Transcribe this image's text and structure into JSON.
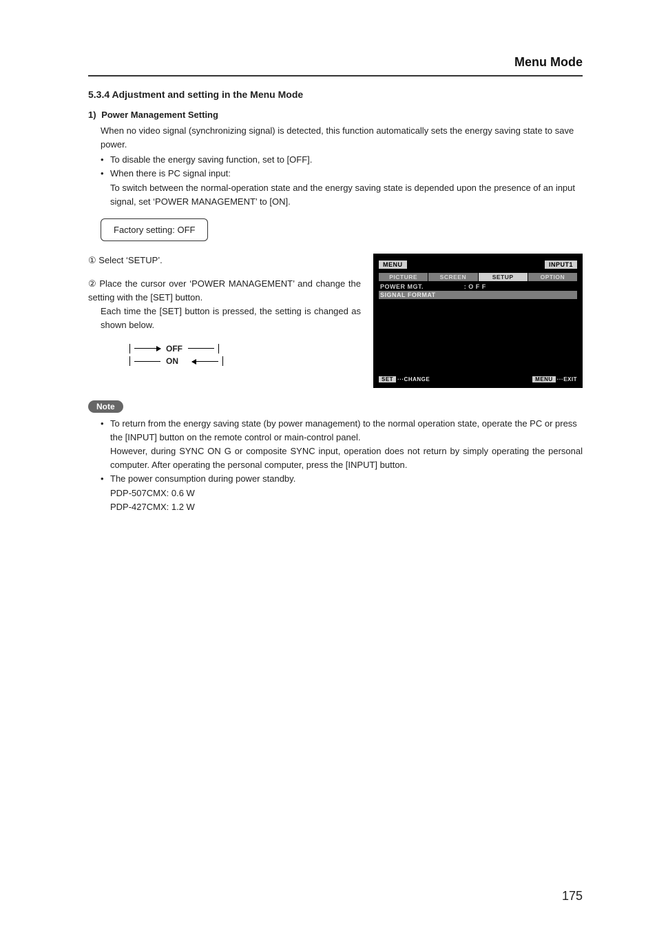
{
  "header": {
    "section_title": "Menu Mode"
  },
  "subsection": {
    "heading": "5.3.4 Adjustment and setting in the Menu Mode"
  },
  "item1": {
    "num": "1)",
    "title": "Power Management Setting",
    "intro": "When no video signal (synchronizing signal) is detected, this function automatically sets the energy saving state to save power.",
    "b1": "To disable the energy saving function, set to [OFF].",
    "b2": "When there is PC signal input:",
    "b2_detail": "To switch between the normal-operation state and the energy saving state is depended upon the presence of an input signal, set ‘POWER MANAGEMENT’ to [ON]."
  },
  "factory": {
    "text": "Factory setting: OFF"
  },
  "steps": {
    "s1_marker": "①",
    "s1_text": "Select ‘SETUP’.",
    "s2_marker": "②",
    "s2_text_a": "Place the cursor over ‘POWER MANAGEMENT’ and change the setting with the [SET] button.",
    "s2_text_b": "Each time the [SET] button is pressed, the setting is changed as shown below."
  },
  "cycle": {
    "off": "OFF",
    "on": "ON"
  },
  "osd": {
    "menu_label": "MENU",
    "input_label": "INPUT1",
    "tabs": {
      "picture": "PICTURE",
      "screen": "SCREEN",
      "setup": "SETUP",
      "option": "OPTION"
    },
    "row1_label": "POWER MGT.",
    "row1_value": ": O F F",
    "row2_label": "SIGNAL FORMAT",
    "footer_set_btn": "SET",
    "footer_set": "···CHANGE",
    "footer_menu_btn": "MENU",
    "footer_menu": "···EXIT"
  },
  "note": {
    "label": "Note",
    "n1a": "To return from the energy saving state (by power management) to the normal operation state, operate the PC or press the [INPUT] button on the remote control or main-control panel.",
    "n1b": "However, during SYNC ON G or composite SYNC input, operation does not return by simply operating the personal computer. After operating the personal computer, press the [INPUT] button.",
    "n2": "The power consumption during power standby.",
    "n2a": "PDP-507CMX: 0.6 W",
    "n2b": "PDP-427CMX: 1.2 W"
  },
  "page_number": "175"
}
